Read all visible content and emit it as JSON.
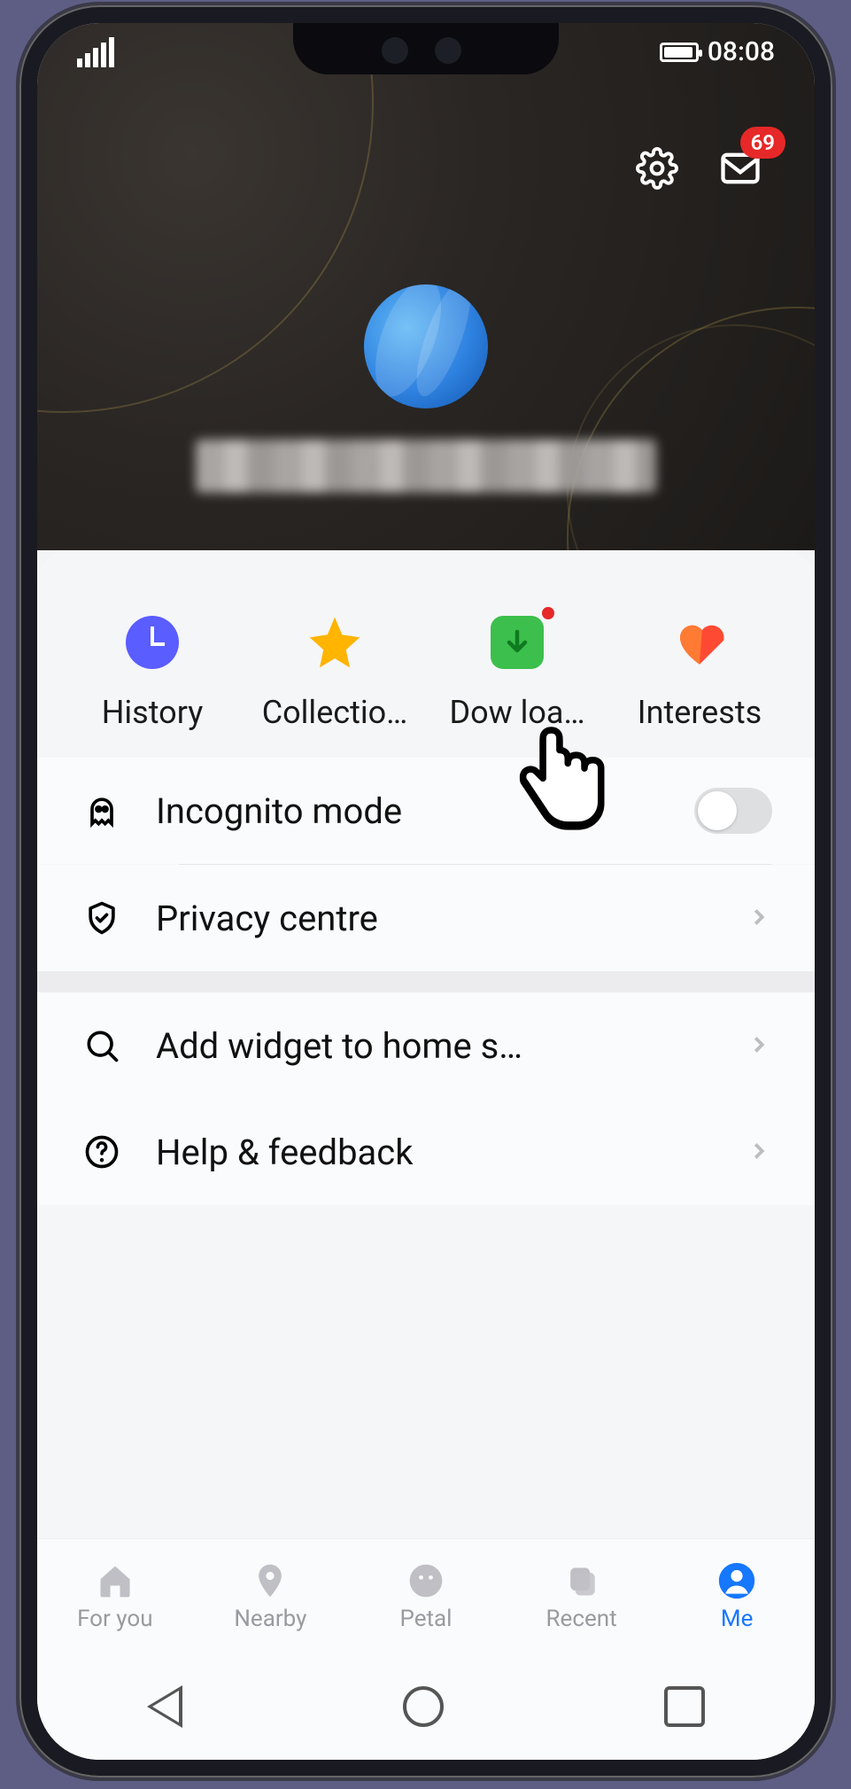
{
  "statusbar": {
    "time": "08:08"
  },
  "header": {
    "messages_badge": "69"
  },
  "quick": {
    "history": {
      "label": "History"
    },
    "collections": {
      "label": "Collectio…"
    },
    "downloads": {
      "label": "Dow  loa…"
    },
    "interests": {
      "label": "Interests"
    }
  },
  "settings": {
    "incognito": {
      "label": "Incognito mode",
      "on": false
    },
    "privacy": {
      "label": "Privacy centre"
    },
    "widget": {
      "label": "Add widget to home s…"
    },
    "help": {
      "label": "Help & feedback"
    }
  },
  "tabs": {
    "foryou": {
      "label": "For you"
    },
    "nearby": {
      "label": "Nearby"
    },
    "petal": {
      "label": "Petal"
    },
    "recent": {
      "label": "Recent"
    },
    "me": {
      "label": "Me"
    }
  }
}
